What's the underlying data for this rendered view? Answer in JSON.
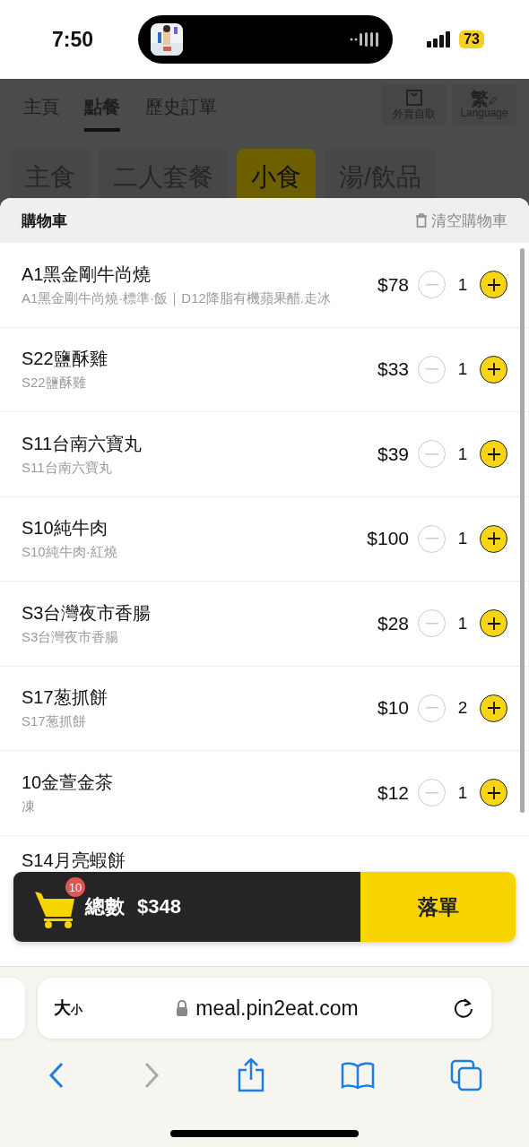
{
  "status_bar": {
    "time": "7:50",
    "battery": "73"
  },
  "nav_tabs": [
    {
      "label": "主頁",
      "selected": false
    },
    {
      "label": "點餐",
      "selected": true
    },
    {
      "label": "歷史訂單",
      "selected": false
    }
  ],
  "header_buttons": [
    {
      "kind": "takeaway",
      "label": "外賣自取"
    },
    {
      "kind": "language",
      "glyph": "繁",
      "label": "Language"
    }
  ],
  "categories": [
    {
      "label": "主食",
      "selected": false
    },
    {
      "label": "二人套餐",
      "selected": false
    },
    {
      "label": "小食",
      "selected": true
    },
    {
      "label": "湯/飲品",
      "selected": false
    }
  ],
  "cart": {
    "title": "購物車",
    "clear_label": "清空購物車",
    "items": [
      {
        "name": "A1黑金剛牛尚燒",
        "options": "A1黑金剛牛尚燒·標準·飯｜D12降脂有機蘋果醋.走冰",
        "price": "$78",
        "qty": "1"
      },
      {
        "name": "S22鹽酥雞",
        "options": "S22鹽酥雞",
        "price": "$33",
        "qty": "1"
      },
      {
        "name": "S11台南六寶丸",
        "options": "S11台南六寶丸",
        "price": "$39",
        "qty": "1"
      },
      {
        "name": "S10純牛肉",
        "options": "S10純牛肉·紅燒",
        "price": "$100",
        "qty": "1"
      },
      {
        "name": "S3台灣夜市香腸",
        "options": "S3台灣夜市香腸",
        "price": "$28",
        "qty": "1"
      },
      {
        "name": "S17葱抓餅",
        "options": "S17葱抓餅",
        "price": "$10",
        "qty": "2"
      },
      {
        "name": "10金萱金茶",
        "options": "凍",
        "price": "$12",
        "qty": "1"
      },
      {
        "name": "S14月亮蝦餅"
      }
    ]
  },
  "checkout": {
    "count": "10",
    "total_label": "總數",
    "total": "$348",
    "submit": "落單"
  },
  "browser": {
    "text_size_large": "大",
    "text_size_small": "小",
    "url": "meal.pin2eat.com"
  }
}
